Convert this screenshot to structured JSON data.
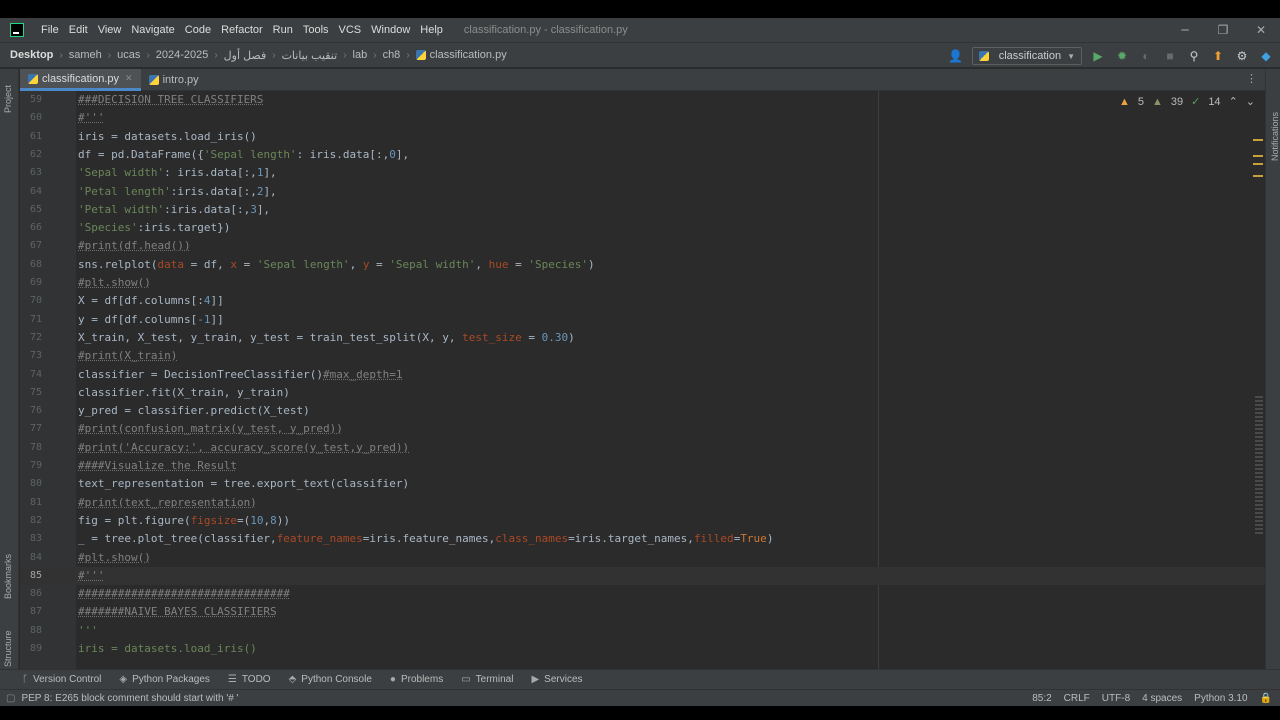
{
  "menu": {
    "items": [
      "File",
      "Edit",
      "View",
      "Navigate",
      "Code",
      "Refactor",
      "Run",
      "Tools",
      "VCS",
      "Window",
      "Help"
    ],
    "window_title": "classification.py - classification.py"
  },
  "navbar": {
    "breadcrumbs": [
      "Desktop",
      "sameh",
      "ucas",
      "2024-2025",
      "فصل أول",
      "تنقيب بيانات",
      "lab",
      "ch8",
      "classification.py"
    ],
    "run_config": "classification"
  },
  "tabs": [
    {
      "label": "classification.py",
      "active": true
    },
    {
      "label": "intro.py",
      "active": false
    }
  ],
  "inspections": {
    "warnings": "5",
    "weak_warnings": "39",
    "typos": "14"
  },
  "editor": {
    "current_line": "85",
    "lines": [
      {
        "n": "59",
        "t": [
          [
            "c",
            "###DECISION TREE CLASSIFIERS"
          ]
        ]
      },
      {
        "n": "60",
        "t": [
          [
            "c",
            "#'''"
          ]
        ]
      },
      {
        "n": "61",
        "t": [
          [
            "p",
            "iris = datasets.load_iris()"
          ]
        ]
      },
      {
        "n": "62",
        "t": [
          [
            "p",
            "df = pd.DataFrame({"
          ],
          [
            "s",
            "'Sepal length'"
          ],
          [
            "p",
            ": iris.data[:,"
          ],
          [
            "n",
            "0"
          ],
          [
            "p",
            "],"
          ]
        ]
      },
      {
        "n": "63",
        "t": [
          [
            "s",
            "'Sepal width'"
          ],
          [
            "p",
            ": iris.data[:,"
          ],
          [
            "n",
            "1"
          ],
          [
            "p",
            "],"
          ]
        ]
      },
      {
        "n": "64",
        "t": [
          [
            "s",
            "'Petal length'"
          ],
          [
            "p",
            ":iris.data[:,"
          ],
          [
            "n",
            "2"
          ],
          [
            "p",
            "],"
          ]
        ]
      },
      {
        "n": "65",
        "t": [
          [
            "s",
            "'Petal width'"
          ],
          [
            "p",
            ":iris.data[:,"
          ],
          [
            "n",
            "3"
          ],
          [
            "p",
            "],"
          ]
        ]
      },
      {
        "n": "66",
        "t": [
          [
            "s",
            "'Species'"
          ],
          [
            "p",
            ":iris.target})"
          ]
        ]
      },
      {
        "n": "67",
        "t": [
          [
            "c",
            "#print(df.head())"
          ]
        ]
      },
      {
        "n": "68",
        "t": [
          [
            "p",
            "sns.relplot("
          ],
          [
            "k",
            "data"
          ],
          [
            "p",
            " = df, "
          ],
          [
            "k",
            "x"
          ],
          [
            "p",
            " = "
          ],
          [
            "s",
            "'Sepal length'"
          ],
          [
            "p",
            ", "
          ],
          [
            "k",
            "y"
          ],
          [
            "p",
            " = "
          ],
          [
            "s",
            "'Sepal width'"
          ],
          [
            "p",
            ", "
          ],
          [
            "k",
            "hue"
          ],
          [
            "p",
            " = "
          ],
          [
            "s",
            "'Species'"
          ],
          [
            "p",
            ")"
          ]
        ]
      },
      {
        "n": "69",
        "t": [
          [
            "c",
            "#plt.show()"
          ]
        ]
      },
      {
        "n": "70",
        "t": [
          [
            "p",
            "X = df[df.columns[:"
          ],
          [
            "n",
            "4"
          ],
          [
            "p",
            "]]"
          ]
        ]
      },
      {
        "n": "71",
        "t": [
          [
            "p",
            "y = df[df.columns["
          ],
          [
            "n",
            "-1"
          ],
          [
            "p",
            "]]"
          ]
        ]
      },
      {
        "n": "72",
        "t": [
          [
            "p",
            "X_train, X_test, y_train, y_test = train_test_split(X, y, "
          ],
          [
            "k",
            "test_size"
          ],
          [
            "p",
            " = "
          ],
          [
            "n",
            "0.30"
          ],
          [
            "p",
            ")"
          ]
        ]
      },
      {
        "n": "73",
        "t": [
          [
            "c",
            "#print(X_train)"
          ]
        ]
      },
      {
        "n": "74",
        "t": [
          [
            "p",
            "classifier = DecisionTreeClassifier()"
          ],
          [
            "c",
            "#max_depth=1"
          ]
        ]
      },
      {
        "n": "75",
        "t": [
          [
            "p",
            "classifier.fit(X_train, y_train)"
          ]
        ]
      },
      {
        "n": "76",
        "t": [
          [
            "p",
            "y_pred = classifier.predict(X_test)"
          ]
        ]
      },
      {
        "n": "77",
        "t": [
          [
            "c",
            "#print(confusion_matrix(y_test, y_pred))"
          ]
        ]
      },
      {
        "n": "78",
        "t": [
          [
            "c",
            "#print('Accuracy:', accuracy_score(y_test,y_pred))"
          ]
        ]
      },
      {
        "n": "79",
        "t": [
          [
            "c",
            "####Visualize the Result"
          ]
        ]
      },
      {
        "n": "80",
        "t": [
          [
            "p",
            "text_representation = tree.export_text(classifier)"
          ]
        ]
      },
      {
        "n": "81",
        "t": [
          [
            "c",
            "#print(text_representation)"
          ]
        ]
      },
      {
        "n": "82",
        "t": [
          [
            "p",
            "fig = plt.figure("
          ],
          [
            "k",
            "figsize"
          ],
          [
            "p",
            "=("
          ],
          [
            "n",
            "10"
          ],
          [
            "p",
            ","
          ],
          [
            "n",
            "8"
          ],
          [
            "p",
            "))"
          ]
        ]
      },
      {
        "n": "83",
        "t": [
          [
            "p",
            "_ = tree.plot_tree(classifier,"
          ],
          [
            "k",
            "feature_names"
          ],
          [
            "p",
            "=iris.feature_names,"
          ],
          [
            "k",
            "class_names"
          ],
          [
            "p",
            "=iris.target_names,"
          ],
          [
            "k",
            "filled"
          ],
          [
            "p",
            "="
          ],
          [
            "b",
            "True"
          ],
          [
            "p",
            ")"
          ]
        ]
      },
      {
        "n": "84",
        "t": [
          [
            "c",
            "#plt.show()"
          ]
        ]
      },
      {
        "n": "85",
        "t": [
          [
            "c",
            "#'''"
          ]
        ]
      },
      {
        "n": "86",
        "t": [
          [
            "c",
            "################################"
          ]
        ]
      },
      {
        "n": "87",
        "t": [
          [
            "c",
            "#######NAIVE BAYES CLASSIFIERS"
          ]
        ]
      },
      {
        "n": "88",
        "t": [
          [
            "s",
            "'''"
          ]
        ]
      },
      {
        "n": "89",
        "t": [
          [
            "s",
            "iris = datasets.load_iris()"
          ]
        ]
      }
    ]
  },
  "tool_windows": [
    {
      "label": "Version Control",
      "icon": "branch-icon",
      "glyph": "ᚴ"
    },
    {
      "label": "Python Packages",
      "icon": "packages-icon",
      "glyph": "◈"
    },
    {
      "label": "TODO",
      "icon": "todo-icon",
      "glyph": "☰"
    },
    {
      "label": "Python Console",
      "icon": "python-console-icon",
      "glyph": "⬘"
    },
    {
      "label": "Problems",
      "icon": "problems-icon",
      "glyph": "●"
    },
    {
      "label": "Terminal",
      "icon": "terminal-icon",
      "glyph": "▭"
    },
    {
      "label": "Services",
      "icon": "services-icon",
      "glyph": "▶"
    }
  ],
  "statusbar": {
    "message": "PEP 8: E265 block comment should start with '# '",
    "position": "85:2",
    "line_sep": "CRLF",
    "encoding": "UTF-8",
    "indent": "4 spaces",
    "interpreter": "Python 3.10"
  },
  "side_labels": {
    "project": "Project",
    "bookmarks": "Bookmarks",
    "structure": "Structure",
    "notifications": "Notifications"
  },
  "colors": {
    "keyword_param": "#aa4926",
    "string": "#6a8759",
    "comment": "#808080",
    "number": "#6897bb",
    "accent": "#4a88c7"
  }
}
